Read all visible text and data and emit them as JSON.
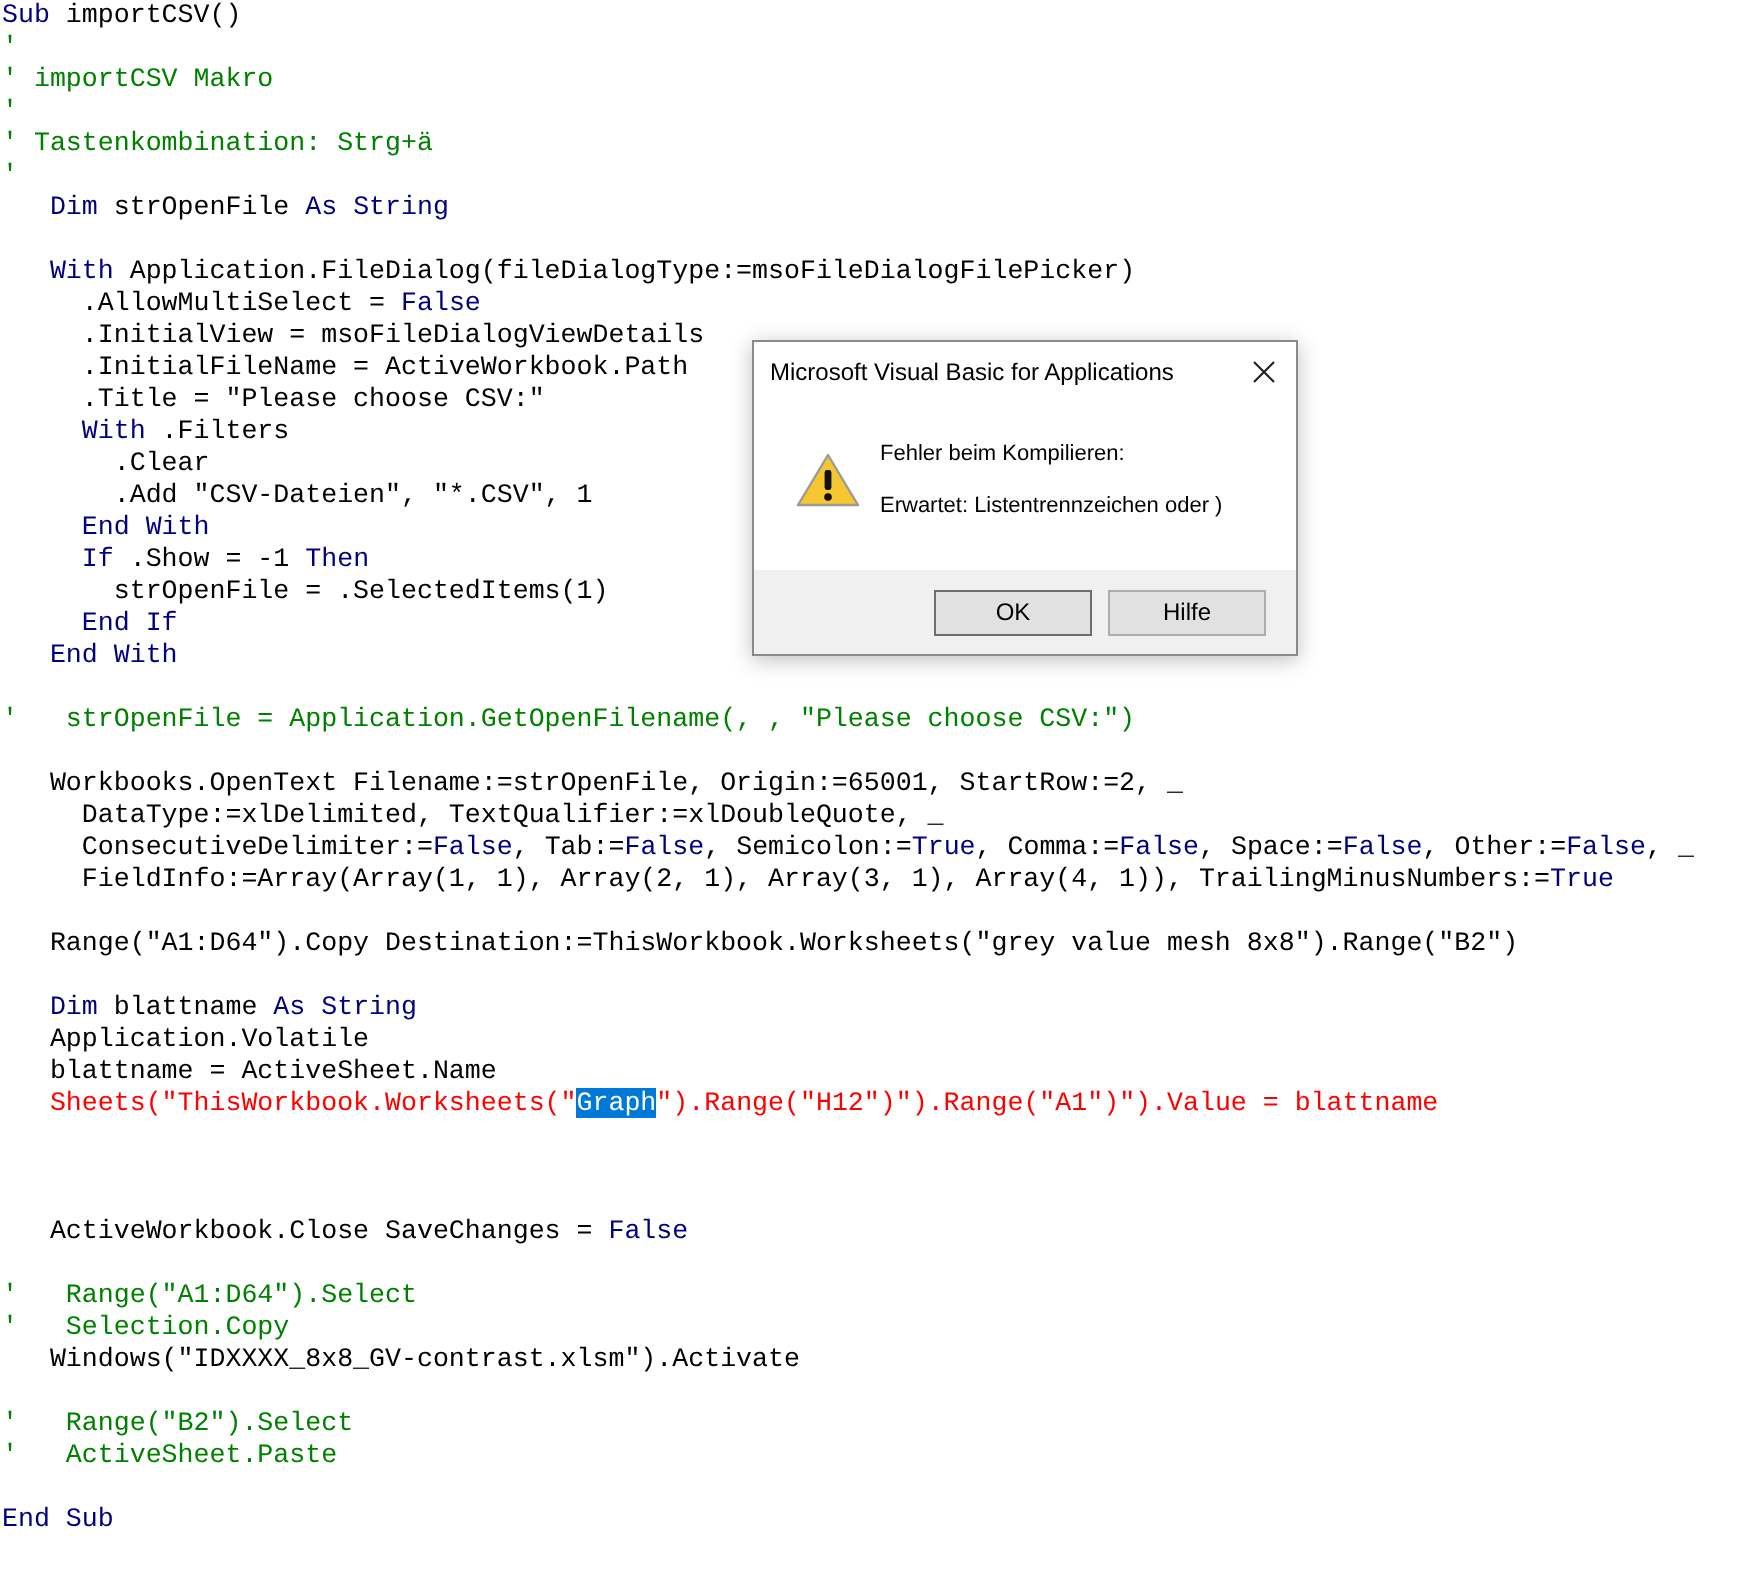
{
  "editor": {
    "lines": [
      {
        "kind": "code",
        "segments": [
          {
            "text": "Sub",
            "kind": "keyword"
          },
          {
            "text": " importCSV()",
            "kind": "plain"
          }
        ]
      },
      {
        "kind": "code",
        "segments": [
          {
            "text": "'",
            "kind": "comment"
          }
        ]
      },
      {
        "kind": "code",
        "segments": [
          {
            "text": "' importCSV Makro",
            "kind": "comment"
          }
        ]
      },
      {
        "kind": "code",
        "segments": [
          {
            "text": "'",
            "kind": "comment"
          }
        ]
      },
      {
        "kind": "code",
        "segments": [
          {
            "text": "' Tastenkombination: Strg+ä",
            "kind": "comment"
          }
        ]
      },
      {
        "kind": "code",
        "segments": [
          {
            "text": "'",
            "kind": "comment"
          }
        ]
      },
      {
        "kind": "code",
        "segments": [
          {
            "text": "   Dim",
            "kind": "keyword"
          },
          {
            "text": " strOpenFile ",
            "kind": "plain"
          },
          {
            "text": "As String",
            "kind": "keyword"
          }
        ]
      },
      {
        "kind": "blank"
      },
      {
        "kind": "code",
        "segments": [
          {
            "text": "   With",
            "kind": "keyword"
          },
          {
            "text": " Application.FileDialog(fileDialogType:=msoFileDialogFilePicker)",
            "kind": "plain"
          }
        ]
      },
      {
        "kind": "code",
        "segments": [
          {
            "text": "     .AllowMultiSelect = ",
            "kind": "plain"
          },
          {
            "text": "False",
            "kind": "keyword"
          }
        ]
      },
      {
        "kind": "code",
        "segments": [
          {
            "text": "     .InitialView = msoFileDialogViewDetails",
            "kind": "plain"
          }
        ]
      },
      {
        "kind": "code",
        "segments": [
          {
            "text": "     .InitialFileName = ActiveWorkbook.Path",
            "kind": "plain"
          }
        ]
      },
      {
        "kind": "code",
        "segments": [
          {
            "text": "     .Title = \"Please choose CSV:\"",
            "kind": "plain"
          }
        ]
      },
      {
        "kind": "code",
        "segments": [
          {
            "text": "     With",
            "kind": "keyword"
          },
          {
            "text": " .Filters",
            "kind": "plain"
          }
        ]
      },
      {
        "kind": "code",
        "segments": [
          {
            "text": "       .Clear",
            "kind": "plain"
          }
        ]
      },
      {
        "kind": "code",
        "segments": [
          {
            "text": "       .Add \"CSV-Dateien\", \"*.CSV\", 1",
            "kind": "plain"
          }
        ]
      },
      {
        "kind": "code",
        "segments": [
          {
            "text": "     End With",
            "kind": "keyword"
          }
        ]
      },
      {
        "kind": "code",
        "segments": [
          {
            "text": "     If",
            "kind": "keyword"
          },
          {
            "text": " .Show = -1 ",
            "kind": "plain"
          },
          {
            "text": "Then",
            "kind": "keyword"
          }
        ]
      },
      {
        "kind": "code",
        "segments": [
          {
            "text": "       strOpenFile = .SelectedItems(1)",
            "kind": "plain"
          }
        ]
      },
      {
        "kind": "code",
        "segments": [
          {
            "text": "     End If",
            "kind": "keyword"
          }
        ]
      },
      {
        "kind": "code",
        "segments": [
          {
            "text": "   End With",
            "kind": "keyword"
          }
        ]
      },
      {
        "kind": "blank"
      },
      {
        "kind": "code",
        "segments": [
          {
            "text": "'   strOpenFile = Application.GetOpenFilename(, , \"Please choose CSV:\")",
            "kind": "comment"
          }
        ]
      },
      {
        "kind": "blank"
      },
      {
        "kind": "code",
        "segments": [
          {
            "text": "   Workbooks.OpenText Filename:=strOpenFile, Origin:=65001, StartRow:=2, _",
            "kind": "plain"
          }
        ]
      },
      {
        "kind": "code",
        "segments": [
          {
            "text": "     DataType:=xlDelimited, TextQualifier:=xlDoubleQuote, _",
            "kind": "plain"
          }
        ]
      },
      {
        "kind": "code",
        "segments": [
          {
            "text": "     ConsecutiveDelimiter:=",
            "kind": "plain"
          },
          {
            "text": "False",
            "kind": "keyword"
          },
          {
            "text": ", Tab:=",
            "kind": "plain"
          },
          {
            "text": "False",
            "kind": "keyword"
          },
          {
            "text": ", Semicolon:=",
            "kind": "plain"
          },
          {
            "text": "True",
            "kind": "keyword"
          },
          {
            "text": ", Comma:=",
            "kind": "plain"
          },
          {
            "text": "False",
            "kind": "keyword"
          },
          {
            "text": ", Space:=",
            "kind": "plain"
          },
          {
            "text": "False",
            "kind": "keyword"
          },
          {
            "text": ", Other:=",
            "kind": "plain"
          },
          {
            "text": "False",
            "kind": "keyword"
          },
          {
            "text": ", _",
            "kind": "plain"
          }
        ]
      },
      {
        "kind": "code",
        "segments": [
          {
            "text": "     FieldInfo:=Array(Array(1, 1), Array(2, 1), Array(3, 1), Array(4, 1)), TrailingMinusNumbers:=",
            "kind": "plain"
          },
          {
            "text": "True",
            "kind": "keyword"
          }
        ]
      },
      {
        "kind": "blank"
      },
      {
        "kind": "code",
        "segments": [
          {
            "text": "   Range(\"A1:D64\").Copy Destination:=ThisWorkbook.Worksheets(\"grey value mesh 8x8\").Range(\"B2\")",
            "kind": "plain"
          }
        ]
      },
      {
        "kind": "blank"
      },
      {
        "kind": "code",
        "segments": [
          {
            "text": "   Dim",
            "kind": "keyword"
          },
          {
            "text": " blattname ",
            "kind": "plain"
          },
          {
            "text": "As String",
            "kind": "keyword"
          }
        ]
      },
      {
        "kind": "code",
        "segments": [
          {
            "text": "   Application.Volatile",
            "kind": "plain"
          }
        ]
      },
      {
        "kind": "code",
        "segments": [
          {
            "text": "   blattname = ActiveSheet.Name",
            "kind": "plain"
          }
        ]
      },
      {
        "kind": "code",
        "segments": [
          {
            "text": "   Sheets(\"ThisWorkbook.Worksheets(\"",
            "kind": "error"
          },
          {
            "text": "Graph",
            "kind": "selection"
          },
          {
            "text": "\").Range(\"H12\")\").Range(\"A1\")\").Value = blattname",
            "kind": "error"
          }
        ]
      },
      {
        "kind": "blank"
      },
      {
        "kind": "blank"
      },
      {
        "kind": "blank"
      },
      {
        "kind": "code",
        "segments": [
          {
            "text": "   ActiveWorkbook.Close SaveChanges = ",
            "kind": "plain"
          },
          {
            "text": "False",
            "kind": "keyword"
          }
        ]
      },
      {
        "kind": "blank"
      },
      {
        "kind": "code",
        "segments": [
          {
            "text": "'   Range(\"A1:D64\").Select",
            "kind": "comment"
          }
        ]
      },
      {
        "kind": "code",
        "segments": [
          {
            "text": "'   Selection.Copy",
            "kind": "comment"
          }
        ]
      },
      {
        "kind": "code",
        "segments": [
          {
            "text": "   Windows(\"IDXXXX_8x8_GV-contrast.xlsm\").Activate",
            "kind": "plain"
          }
        ]
      },
      {
        "kind": "blank"
      },
      {
        "kind": "code",
        "segments": [
          {
            "text": "'   Range(\"B2\").Select",
            "kind": "comment"
          }
        ]
      },
      {
        "kind": "code",
        "segments": [
          {
            "text": "'   ActiveSheet.Paste",
            "kind": "comment"
          }
        ]
      },
      {
        "kind": "blank"
      },
      {
        "kind": "code",
        "segments": [
          {
            "text": "End Sub",
            "kind": "keyword"
          }
        ]
      }
    ]
  },
  "dialog": {
    "title": "Microsoft Visual Basic for Applications",
    "messages": [
      "Fehler beim Kompilieren:",
      "Erwartet: Listentrennzeichen oder )"
    ],
    "buttons": [
      {
        "label": "OK",
        "default": true
      },
      {
        "label": "Hilfe",
        "default": false
      }
    ]
  }
}
